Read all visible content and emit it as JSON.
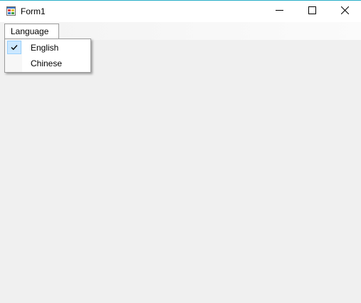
{
  "window": {
    "title": "Form1"
  },
  "menu": {
    "language_label": "Language",
    "items": [
      {
        "label": "English",
        "checked": true
      },
      {
        "label": "Chinese",
        "checked": false
      }
    ]
  },
  "icons": {
    "app": "form-app-icon",
    "minimize": "minimize-icon",
    "maximize": "maximize-icon",
    "close": "close-icon",
    "check": "checkmark-icon"
  },
  "colors": {
    "check_highlight": "#cce8ff",
    "check_border": "#99d1ff",
    "window_accent": "#2ab0c8",
    "client_background": "#f0f0f0"
  }
}
